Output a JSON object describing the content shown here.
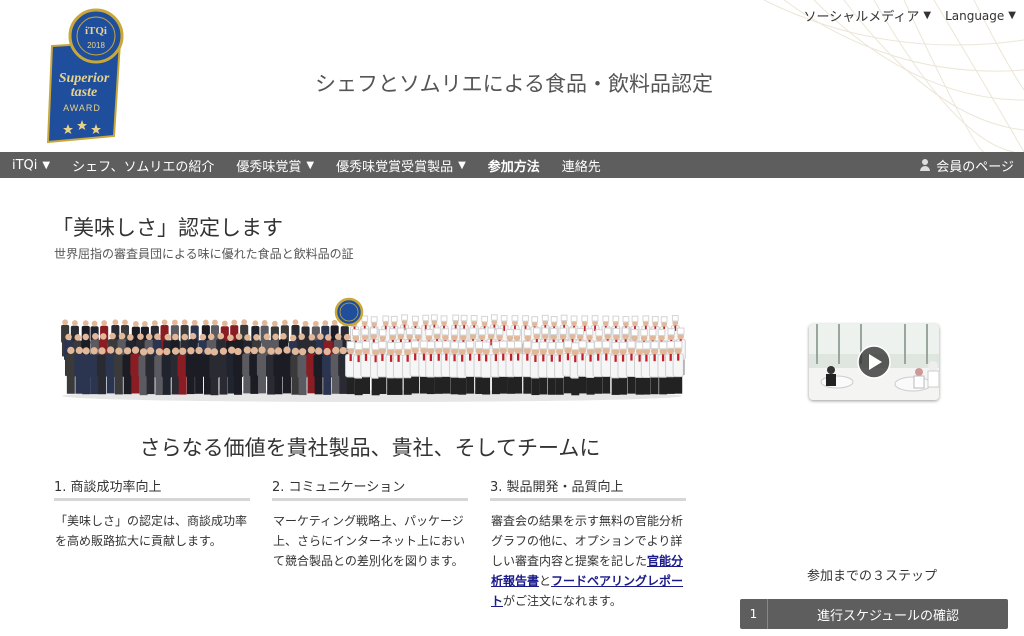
{
  "header": {
    "site_title": "シェフとソムリエによる食品・飲料品認定",
    "logo": {
      "year": "2018",
      "brand": "iTQi",
      "award_line1": "Superior",
      "award_line2": "taste",
      "award_line3": "AWARD"
    },
    "top_links": [
      {
        "label": "ソーシャルメディア",
        "icon": "triangle-down-icon"
      },
      {
        "label": "Language",
        "icon": "triangle-down-icon"
      }
    ]
  },
  "nav": {
    "items": [
      {
        "label": "iTQi",
        "dropdown": true,
        "bold": false
      },
      {
        "label": "シェフ、ソムリエの紹介",
        "dropdown": false,
        "bold": false
      },
      {
        "label": "優秀味覚賞",
        "dropdown": true,
        "bold": false
      },
      {
        "label": "優秀味覚賞受賞製品",
        "dropdown": true,
        "bold": false
      },
      {
        "label": "参加方法",
        "dropdown": false,
        "bold": true
      },
      {
        "label": "連絡先",
        "dropdown": false,
        "bold": false
      }
    ],
    "member_page": "会員のページ"
  },
  "hero": {
    "title": "「美味しさ」認定します",
    "subtitle": "世界屈指の審査員団による味に優れた食品と飲料品の証"
  },
  "value_heading": "さらなる価値を貴社製品、貴社、そしてチームに",
  "columns": [
    {
      "title": "1. 商談成功率向上",
      "body": "「美味しさ」の認定は、商談成功率を高め販路拡大に貢献します。"
    },
    {
      "title": "2. コミュニケーション",
      "body": "マーケティング戦略上、パッケージ上、さらにインターネット上において競合製品との差別化を図ります。"
    },
    {
      "title": "3. 製品開発・品質向上",
      "body_pre": "審査会の結果を示す無料の官能分析グラフの他に、オプションでより詳しい審査内容と提案を記した",
      "link1": "官能分析報告書",
      "body_mid": "と",
      "link2": "フードペアリングレポート",
      "body_post": "がご注文になれます。"
    }
  ],
  "sidebar": {
    "steps_label": "参加までの３ステップ",
    "step1": {
      "number": "1",
      "label": "進行スケジュールの確認"
    }
  },
  "colors": {
    "nav_bg": "#5e5e5e",
    "logo_blue": "#1f4e9c",
    "logo_gold": "#c9a83a",
    "link": "#1a1a8a"
  }
}
